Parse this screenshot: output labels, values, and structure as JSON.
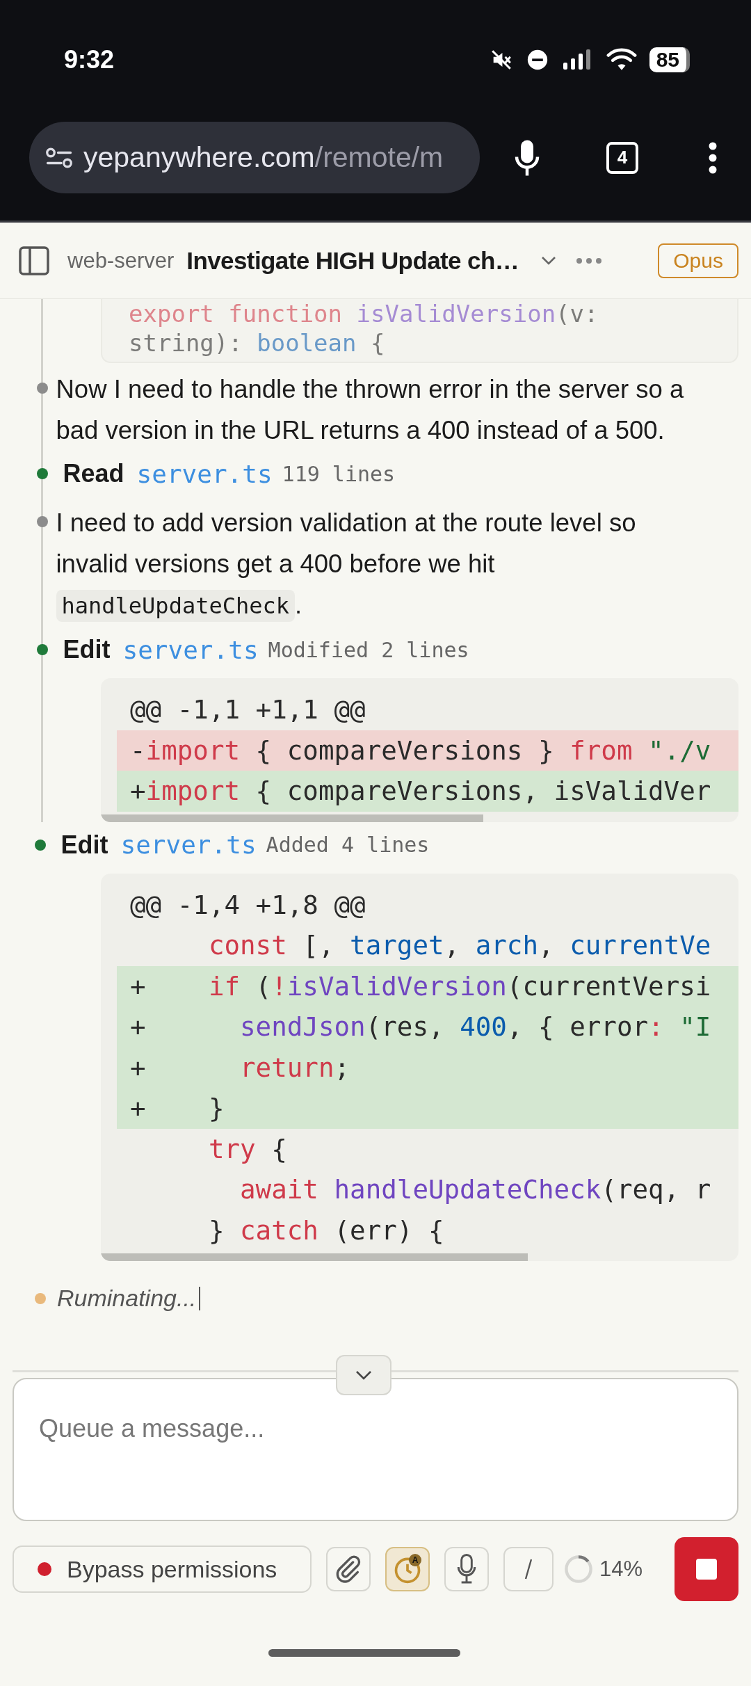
{
  "status_bar": {
    "time": "9:32",
    "battery": "85"
  },
  "browser": {
    "url_host": "yepanywhere.com",
    "url_path": "/remote/m",
    "tab_count": "4"
  },
  "header": {
    "project": "web-server",
    "title": "Investigate HIGH Update ch…",
    "model": "Opus"
  },
  "faded_snippet": [
    [
      {
        "t": "export",
        "kind": "kw"
      },
      {
        "t": " function ",
        "kind": "kw"
      },
      {
        "t": "isValidVersion",
        "kind": "fn"
      },
      {
        "t": "(v:",
        "kind": "plain"
      }
    ],
    [
      {
        "t": "string): ",
        "kind": "plain"
      },
      {
        "t": "boolean",
        "kind": "var"
      },
      {
        "t": " {",
        "kind": "plain"
      }
    ]
  ],
  "timeline": [
    {
      "kind": "message",
      "color": "#8c8c8c",
      "text": "Now I need to handle the thrown error in the server so a bad version in the URL returns a 400 instead of a 500."
    },
    {
      "kind": "tool",
      "color": "#1f7a3a",
      "action": "Read",
      "file": "server.ts",
      "summary": "119 lines"
    },
    {
      "kind": "message",
      "color": "#8c8c8c",
      "text": "I need to add version validation at the route level so invalid versions get a 400 before we hit ",
      "code": "handleUpdateCheck",
      "after": "."
    },
    {
      "kind": "tool",
      "color": "#1f7a3a",
      "action": "Edit",
      "file": "server.ts",
      "summary": "Modified 2 lines",
      "diff": [
        {
          "kind": "hunk",
          "tokens": [
            {
              "t": "@@ -1,1 +1,1 @@",
              "kind": "plain"
            }
          ]
        },
        {
          "kind": "del",
          "tokens": [
            {
              "t": "-",
              "kind": "plain"
            },
            {
              "t": "import",
              "kind": "kw"
            },
            {
              "t": " { compareVersions } ",
              "kind": "plain"
            },
            {
              "t": "from",
              "kind": "kw"
            },
            {
              "t": " \"./v",
              "kind": "str"
            }
          ]
        },
        {
          "kind": "add",
          "tokens": [
            {
              "t": "+",
              "kind": "plain"
            },
            {
              "t": "import",
              "kind": "kw"
            },
            {
              "t": " { compareVersions, isValidVer",
              "kind": "plain"
            }
          ]
        }
      ]
    },
    {
      "kind": "tool",
      "color": "#1f7a3a",
      "action": "Edit",
      "file": "server.ts",
      "summary": "Added 4 lines",
      "diff": [
        {
          "kind": "hunk",
          "tokens": [
            {
              "t": "@@ -1,4 +1,8 @@",
              "kind": "plain"
            }
          ]
        },
        {
          "kind": "ctx",
          "tokens": [
            {
              "t": "     const",
              "kind": "kw"
            },
            {
              "t": " [, ",
              "kind": "plain"
            },
            {
              "t": "target",
              "kind": "var"
            },
            {
              "t": ", ",
              "kind": "plain"
            },
            {
              "t": "arch",
              "kind": "var"
            },
            {
              "t": ", ",
              "kind": "plain"
            },
            {
              "t": "currentVe",
              "kind": "var"
            }
          ]
        },
        {
          "kind": "add",
          "tokens": [
            {
              "t": "+    ",
              "kind": "plain"
            },
            {
              "t": "if",
              "kind": "kw"
            },
            {
              "t": " (",
              "kind": "plain"
            },
            {
              "t": "!",
              "kind": "kw"
            },
            {
              "t": "isValidVersion",
              "kind": "fn"
            },
            {
              "t": "(currentVersi",
              "kind": "plain"
            }
          ]
        },
        {
          "kind": "add",
          "tokens": [
            {
              "t": "+      ",
              "kind": "plain"
            },
            {
              "t": "sendJson",
              "kind": "fn"
            },
            {
              "t": "(res, ",
              "kind": "plain"
            },
            {
              "t": "400",
              "kind": "num"
            },
            {
              "t": ", { error",
              "kind": "plain"
            },
            {
              "t": ":",
              "kind": "kw"
            },
            {
              "t": " \"I",
              "kind": "str"
            }
          ]
        },
        {
          "kind": "add",
          "tokens": [
            {
              "t": "+      ",
              "kind": "plain"
            },
            {
              "t": "return",
              "kind": "kw"
            },
            {
              "t": ";",
              "kind": "plain"
            }
          ]
        },
        {
          "kind": "add",
          "tokens": [
            {
              "t": "+    }",
              "kind": "plain"
            }
          ]
        },
        {
          "kind": "ctx",
          "tokens": [
            {
              "t": "     try",
              "kind": "kw"
            },
            {
              "t": " {",
              "kind": "plain"
            }
          ]
        },
        {
          "kind": "ctx",
          "tokens": [
            {
              "t": "       await ",
              "kind": "kw"
            },
            {
              "t": "handleUpdateCheck",
              "kind": "fn"
            },
            {
              "t": "(req, r",
              "kind": "plain"
            }
          ]
        },
        {
          "kind": "ctx",
          "tokens": [
            {
              "t": "     } ",
              "kind": "plain"
            },
            {
              "t": "catch",
              "kind": "kw"
            },
            {
              "t": " (err) {",
              "kind": "plain"
            }
          ]
        }
      ]
    }
  ],
  "thinking": {
    "text": "Ruminating...",
    "color": "#e9b97c"
  },
  "composer": {
    "placeholder": "Queue a message..."
  },
  "toolbar": {
    "mode": "Bypass permissions",
    "timer_badge": "A",
    "timer_on": true,
    "context": {
      "level": 0.14,
      "reading": "14%"
    }
  }
}
